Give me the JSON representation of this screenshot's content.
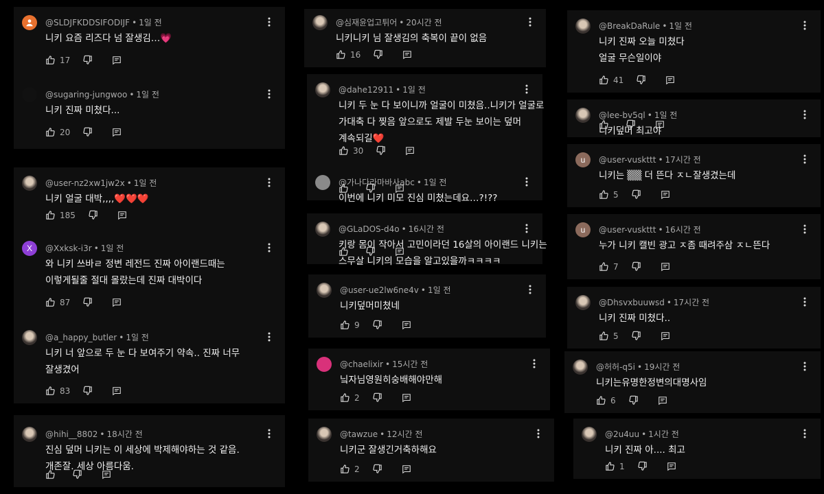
{
  "comments": {
    "c1": {
      "user": "@SLDJFKDDSIFODIJF",
      "time": "1일 전",
      "lines": [
        "니키 요즘 리즈다 넘 잘생김…💗"
      ],
      "likes": "17",
      "avatar": "orange-person"
    },
    "c2": {
      "user": "@sugaring-jungwoo",
      "time": "1일 전",
      "lines": [
        "니키 진짜 미쳤다..."
      ],
      "likes": "20",
      "avatar": "dark"
    },
    "c3": {
      "user": "@user-nz2xw1jw2x",
      "time": "1일 전",
      "lines": [
        "니키 얼굴 대박,,,,❤️❤️❤️"
      ],
      "likes": "185",
      "avatar": "photo"
    },
    "c4": {
      "user": "@Xxksk-i3r",
      "time": "1일 전",
      "lines": [
        "와 니키 쓰바ㄹ 정변 레전드 진짜 아이랜드때는",
        "이렇게될줄 절대 몰랐는데 진짜 대박이다"
      ],
      "likes": "87",
      "avatar": "X"
    },
    "c5": {
      "user": "@a_happy_butler",
      "time": "1일 전",
      "lines": [
        "니키 너 앞으로 두 눈 다 보여주기 약속.. 진짜 너무",
        "잘생겼어"
      ],
      "likes": "83",
      "avatar": "photo"
    },
    "c6": {
      "user": "@hihi__8802",
      "time": "18시간 전",
      "lines": [
        "진심 덮머 니키는 이 세상에 박제해야하는 것 같음.",
        "개존잘. 세상 아름다움."
      ],
      "likes": "",
      "avatar": "photo"
    },
    "c7": {
      "user": "@심재윤업고튀어",
      "time": "20시간 전",
      "lines": [
        "니키니키 님 잘생김의 축복이 끝이 없음"
      ],
      "likes": "16",
      "avatar": "photo"
    },
    "c8": {
      "user": "@dahe12911",
      "time": "1일 전",
      "lines": [
        "니키 두 눈 다 보이니까 얼굴이 미쳤음..니키가 얼굴로",
        "가대축 다 찢음 앞으로도 제발 두눈 보이는 덮머",
        "계속되길❤️"
      ],
      "likes": "30",
      "avatar": "photo"
    },
    "c9": {
      "user": "@가나다라마바사abc",
      "time": "1일 전",
      "lines": [
        "이번에 니키 미모 진심 미쳤는데요…?!??"
      ],
      "likes": "",
      "avatar": "gray"
    },
    "c10": {
      "user": "@GLaDOS-d4o",
      "time": "16시간 전",
      "lines": [
        "키랑 몸이 작아서 고민이라던 16살의 아이랜드 니키는",
        "스무살 니키의 모습을 알고있을까ㅋㅋㅋㅋ"
      ],
      "likes": "",
      "avatar": "photo"
    },
    "c11": {
      "user": "@user-ue2lw6ne4v",
      "time": "1일 전",
      "lines": [
        "니키덮머미쳤네"
      ],
      "likes": "9",
      "avatar": "photo"
    },
    "c12": {
      "user": "@chaelixir",
      "time": "15시간 전",
      "lines": [
        "닠자님영원히숭배해야만해"
      ],
      "likes": "2",
      "avatar": "pink"
    },
    "c13": {
      "user": "@tawzue",
      "time": "12시간 전",
      "lines": [
        "니키군 잘생긴거축하해요"
      ],
      "likes": "2",
      "avatar": "photo"
    },
    "c14": {
      "user": "@BreakDaRule",
      "time": "1일 전",
      "lines": [
        "니키 진짜 오늘 미쳤다",
        "얼굴 무슨일이야"
      ],
      "likes": "41",
      "avatar": "photo"
    },
    "c15": {
      "user": "@lee-bv5ql",
      "time": "1일 전",
      "lines": [
        "니키덮머 최고야"
      ],
      "likes": "",
      "avatar": "photo"
    },
    "c16": {
      "user": "@user-vuskttt",
      "time": "17시간 전",
      "lines": [
        "니키는 ▒▒ 더 뜬다 ㅈㄴ잘생겼는데"
      ],
      "likes": "5",
      "avatar": "u"
    },
    "c17": {
      "user": "@user-vuskttt",
      "time": "16시간 전",
      "lines": [
        "누가 니키 캘빈 광고 ㅈ좀 때려주삼 ㅈㄴ뜬다"
      ],
      "likes": "7",
      "avatar": "u"
    },
    "c18": {
      "user": "@Dhsvxbuuwsd",
      "time": "17시간 전",
      "lines": [
        "니키 진짜 미쳤다.."
      ],
      "likes": "5",
      "avatar": "photo"
    },
    "c19": {
      "user": "@허허-q5i",
      "time": "19시간 전",
      "lines": [
        "니키는유명한정변의대명사임"
      ],
      "likes": "6",
      "avatar": "photo"
    },
    "c20": {
      "user": "@2u4uu",
      "time": "1시간 전",
      "lines": [
        "니키 진짜 아.... 최고"
      ],
      "likes": "1",
      "avatar": "photo"
    }
  },
  "avatar_letters": {
    "x": "X",
    "u": "u"
  },
  "colors": {
    "card_bg": "#0f0f0f",
    "text": "#f1f1f1",
    "meta": "#aaaaaa",
    "orange": "#e8712f",
    "purple": "#8e3fd6",
    "brown": "#8b6a5c",
    "pink": "#d9317a"
  },
  "icons": {
    "like": "thumb-up-icon",
    "dislike": "thumb-down-icon",
    "reply": "reply-icon",
    "menu": "more-vert-icon"
  }
}
